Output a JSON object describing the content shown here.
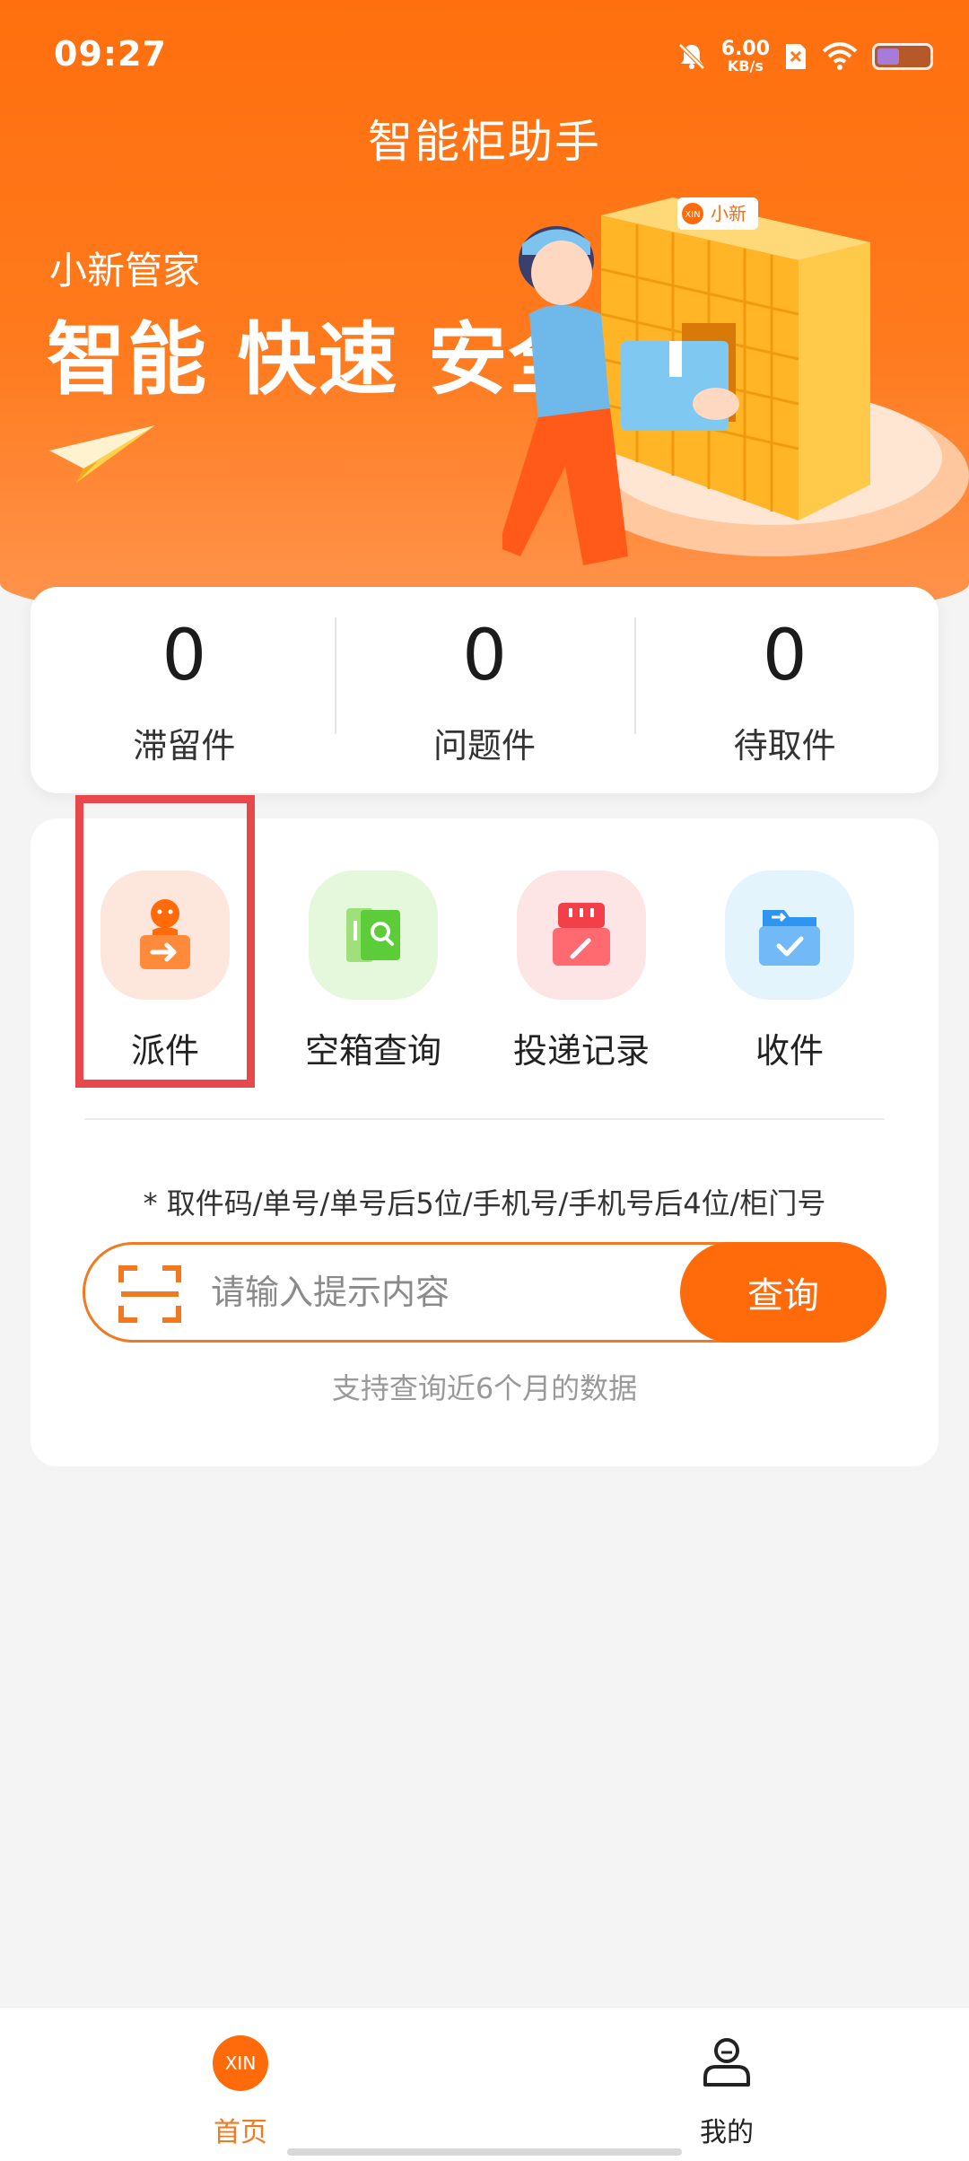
{
  "status_bar": {
    "time": "09:27",
    "net_speed_value": "6.00",
    "net_speed_unit": "KB/s",
    "icons": [
      "bell-muted-icon",
      "sim-off-icon",
      "wifi-icon",
      "battery-icon"
    ]
  },
  "header": {
    "title": "智能柜助手",
    "brand_sub": "小新管家",
    "slogan": "智能 快速 安全",
    "illustration_sign": "小新",
    "illustration_logo": "XIN"
  },
  "stats": [
    {
      "value": "0",
      "label": "滞留件"
    },
    {
      "value": "0",
      "label": "问题件"
    },
    {
      "value": "0",
      "label": "待取件"
    }
  ],
  "actions": [
    {
      "label": "派件",
      "icon": "courier-dispatch-icon"
    },
    {
      "label": "空箱查询",
      "icon": "empty-box-search-icon"
    },
    {
      "label": "投递记录",
      "icon": "delivery-record-icon"
    },
    {
      "label": "收件",
      "icon": "receive-folder-icon"
    }
  ],
  "search": {
    "hint": "* 取件码/单号/单号后5位/手机号/手机号后4位/柜门号",
    "placeholder": "请输入提示内容",
    "value": "",
    "button_label": "查询",
    "support_note": "支持查询近6个月的数据"
  },
  "bottom_nav": {
    "home_label": "首页",
    "home_logo": "XIN",
    "mine_label": "我的"
  },
  "colors": {
    "brand_orange": "#ff6b0a",
    "highlight_red": "#e8484c",
    "active_nav": "#f07a22"
  }
}
